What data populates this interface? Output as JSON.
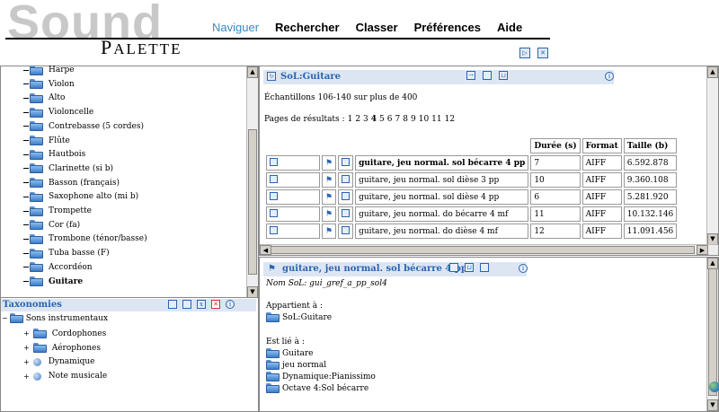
{
  "header": {
    "logo_top": "Sound",
    "logo_bottom_cap": "P",
    "logo_bottom_rest": "ALETTE",
    "nav": [
      {
        "label": "Naviguer",
        "active": true
      },
      {
        "label": "Rechercher",
        "active": false
      },
      {
        "label": "Classer",
        "active": false
      },
      {
        "label": "Préférences",
        "active": false
      },
      {
        "label": "Aide",
        "active": false
      }
    ]
  },
  "instrument_list": [
    "Harpe",
    "Violon",
    "Alto",
    "Violoncelle",
    "Contrebasse (5 cordes)",
    "Flûte",
    "Hautbois",
    "Clarinette (si b)",
    "Basson (français)",
    "Saxophone alto (mi b)",
    "Trompette",
    "Cor (fa)",
    "Trombone (ténor/basse)",
    "Tuba basse (F)",
    "Accordéon",
    "Guitare"
  ],
  "taxonomies": {
    "title": "Taxonomies",
    "root": "Sons instrumentaux",
    "children": [
      "Cordophones",
      "Aérophones",
      "Dynamique",
      "Note musicale"
    ]
  },
  "results": {
    "title": "SoL:Guitare",
    "summary": "Échantillons 106-140 sur plus de 400",
    "pages_label": "Pages de résultats :",
    "pages": [
      "1",
      "2",
      "3",
      "4",
      "5",
      "6",
      "7",
      "8",
      "9",
      "10",
      "11",
      "12"
    ],
    "current_page": "4",
    "columns": [
      "Durée (s)",
      "Format",
      "Taille (b)"
    ],
    "rows": [
      {
        "name": "guitare, jeu normal. sol bécarre 4 pp",
        "duration": "7",
        "format": "AIFF",
        "size": "6.592.878",
        "bold": true
      },
      {
        "name": "guitare, jeu normal. sol dièse 3 pp",
        "duration": "10",
        "format": "AIFF",
        "size": "9.360.108",
        "bold": false
      },
      {
        "name": "guitare, jeu normal. sol dièse 4 pp",
        "duration": "6",
        "format": "AIFF",
        "size": "5.281.920",
        "bold": false
      },
      {
        "name": "guitare, jeu normal. do bécarre 4 mf",
        "duration": "11",
        "format": "AIFF",
        "size": "10.132.146",
        "bold": false
      },
      {
        "name": "guitare, jeu normal. do dièse 4 mf",
        "duration": "12",
        "format": "AIFF",
        "size": "11.091.456",
        "bold": false
      }
    ]
  },
  "detail": {
    "title": "guitare, jeu normal. sol bécarre 4 pp",
    "nom": "Nom SoL: gui_gref_a_pp_sol4",
    "belongs_label": "Appartient à :",
    "belongs": [
      "SoL:Guitare"
    ],
    "linked_label": "Est lié à :",
    "linked": [
      "Guitare",
      "jeu normal",
      "Dynamique:Pianissimo",
      "Octave 4:Sol bécarre"
    ]
  },
  "colors": {
    "accent": "#2a64b0",
    "nav_active": "#3a8bc1",
    "title_bar": "#dce6f3"
  }
}
